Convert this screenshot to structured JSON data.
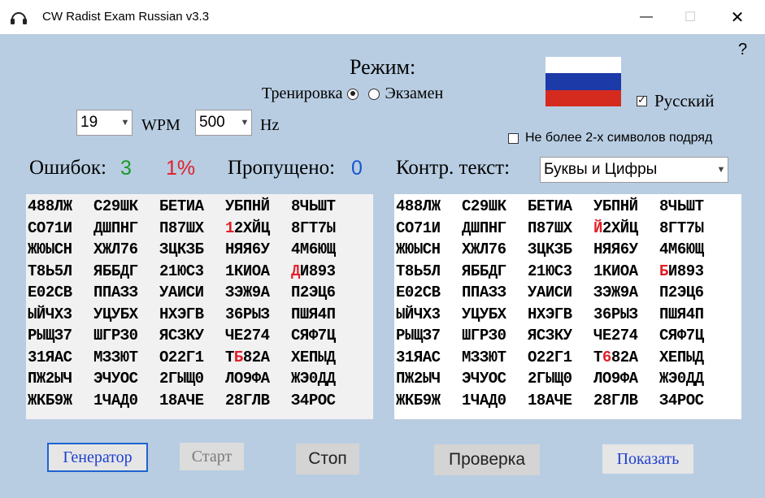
{
  "window": {
    "title": "CW Radist Exam Russian  v3.3",
    "minimize_glyph": "—",
    "maximize_glyph": "☐",
    "close_glyph": "✕",
    "help_glyph": "?"
  },
  "mode": {
    "title": "Режим:",
    "training_label": "Тренировка",
    "exam_label": "Экзамен",
    "selected": "training"
  },
  "flag": {
    "colors": [
      "#ffffff",
      "#1c3aa8",
      "#d52b1e"
    ]
  },
  "language": {
    "label": "Русский",
    "checked": true
  },
  "limit": {
    "label": "Не более 2-х символов подряд",
    "checked": false
  },
  "speed": {
    "wpm_value": "19",
    "wpm_label": "WPM",
    "hz_value": "500",
    "hz_label": "Hz"
  },
  "stats": {
    "errors_label": "Ошибок:",
    "errors_count": "3",
    "errors_percent": "1%",
    "skipped_label": "Пропущено:",
    "skipped_count": "0",
    "control_label": "Контр. текст:",
    "control_value": "Буквы и Цифры"
  },
  "left_grid": [
    [
      "488ЛЖ",
      "С29ШК",
      "БЕТИА",
      "УБПНЙ",
      "8ЧЬШТ"
    ],
    [
      "СО71И",
      "ДШПНГ",
      "П87ШХ",
      "12ХЙЦ",
      "8ГТ7Ы"
    ],
    [
      "ЖЮЫСН",
      "ХЖЛ76",
      "ЗЦКЗБ",
      "НЯЯ6У",
      "4М6ЮЩ"
    ],
    [
      "Т8Ь5Л",
      "ЯББДГ",
      "21ЮС3",
      "1КИОА",
      "ДИ893"
    ],
    [
      "Е02СВ",
      "ППАЗЗ",
      "УАИСИ",
      "ЗЭЖ9А",
      "П2ЭЦ6"
    ],
    [
      "ЫЙЧХ3",
      "УЦУБХ",
      "НХЭГВ",
      "36РЫЗ",
      "ПШЯ4П"
    ],
    [
      "РЫЩЗ7",
      "ШГРЗ0",
      "ЯСЗКУ",
      "ЧЕ274",
      "СЯФ7Ц"
    ],
    [
      "31ЯАС",
      "МЗЗЮТ",
      "О22Г1",
      "ТБ82А",
      "ХЕПЫД"
    ],
    [
      "ПЖ2ЫЧ",
      "ЭЧУОС",
      "2ГЫЩ0",
      "ЛО9ФА",
      "ЖЭ0ДД"
    ],
    [
      "ЖКБ9Ж",
      "1ЧАД0",
      "18АЧЕ",
      "28ГЛВ",
      "З4РОС"
    ]
  ],
  "right_grid": [
    [
      "488ЛЖ",
      "С29ШК",
      "БЕТИА",
      "УБПНЙ",
      "8ЧЬШТ"
    ],
    [
      "СО71И",
      "ДШПНГ",
      "П87ШХ",
      "Й2ХЙЦ",
      "8ГТ7Ы"
    ],
    [
      "ЖЮЫСН",
      "ХЖЛ76",
      "ЗЦКЗБ",
      "НЯЯ6У",
      "4М6ЮЩ"
    ],
    [
      "Т8Ь5Л",
      "ЯББДГ",
      "21ЮС3",
      "1КИОА",
      "БИ893"
    ],
    [
      "Е02СВ",
      "ППАЗЗ",
      "УАИСИ",
      "ЗЭЖ9А",
      "П2ЭЦ6"
    ],
    [
      "ЫЙЧХ3",
      "УЦУБХ",
      "НХЭГВ",
      "36РЫЗ",
      "ПШЯ4П"
    ],
    [
      "РЫЩЗ7",
      "ШГРЗ0",
      "ЯСЗКУ",
      "ЧЕ274",
      "СЯФ7Ц"
    ],
    [
      "31ЯАС",
      "МЗЗЮТ",
      "О22Г1",
      "Т682А",
      "ХЕПЫД"
    ],
    [
      "ПЖ2ЫЧ",
      "ЭЧУОС",
      "2ГЫЩ0",
      "ЛО9ФА",
      "ЖЭ0ДД"
    ],
    [
      "ЖКБ9Ж",
      "1ЧАД0",
      "18АЧЕ",
      "28ГЛВ",
      "З4РОС"
    ]
  ],
  "errors": [
    {
      "row": 1,
      "group": 3,
      "char": 0
    },
    {
      "row": 3,
      "group": 4,
      "char": 0
    },
    {
      "row": 7,
      "group": 3,
      "char": 1
    }
  ],
  "buttons": {
    "generator": "Генератор",
    "start": "Старт",
    "stop": "Стоп",
    "check": "Проверка",
    "show": "Показать"
  },
  "colors": {
    "window_bg": "#b8cde2",
    "error_red": "#e0202a",
    "errors_green": "#1a9a2a",
    "skipped_blue": "#1a55d0",
    "link_blue": "#1e3fcf"
  }
}
